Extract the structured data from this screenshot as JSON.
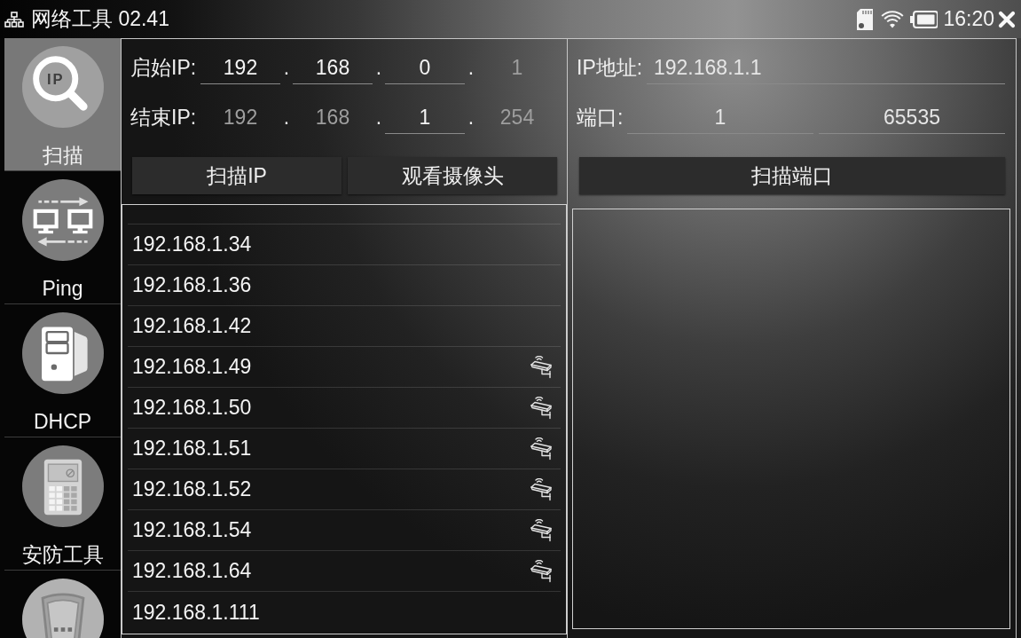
{
  "title_bar": {
    "title": "网络工具 02.41",
    "time": "16:20"
  },
  "sidebar": {
    "items": [
      {
        "kind": "ip-search",
        "icon_text": "IP",
        "label": "扫描",
        "selected": true
      },
      {
        "kind": "ping",
        "label": "Ping",
        "selected": false
      },
      {
        "kind": "dhcp",
        "label": "DHCP",
        "selected": false
      },
      {
        "kind": "security",
        "label": "安防工具",
        "selected": false
      },
      {
        "kind": "router",
        "selected": false
      }
    ]
  },
  "ip_scan": {
    "start": {
      "label": "启始IP:",
      "octets": [
        {
          "value": "192",
          "disabled": false
        },
        {
          "value": "168",
          "disabled": false
        },
        {
          "value": "0",
          "disabled": false
        },
        {
          "value": "1",
          "disabled": true
        }
      ],
      "separators": [
        ".",
        ".",
        "."
      ]
    },
    "end": {
      "label": "结束IP:",
      "octets": [
        {
          "value": "192",
          "disabled": true
        },
        {
          "value": "168",
          "disabled": true
        },
        {
          "value": "1",
          "disabled": false
        },
        {
          "value": "254",
          "disabled": true
        }
      ],
      "separators": [
        ".",
        ".",
        "."
      ]
    },
    "buttons": [
      "扫描IP",
      "观看摄像头"
    ],
    "results": [
      {
        "ip": "192.168.1.34",
        "camera": false
      },
      {
        "ip": "192.168.1.36",
        "camera": false
      },
      {
        "ip": "192.168.1.42",
        "camera": false
      },
      {
        "ip": "192.168.1.49",
        "camera": true
      },
      {
        "ip": "192.168.1.50",
        "camera": true
      },
      {
        "ip": "192.168.1.51",
        "camera": true
      },
      {
        "ip": "192.168.1.52",
        "camera": true
      },
      {
        "ip": "192.168.1.54",
        "camera": true
      },
      {
        "ip": "192.168.1.64",
        "camera": true
      },
      {
        "ip": "192.168.1.111",
        "camera": false
      }
    ]
  },
  "port_scan": {
    "ip_label": "IP地址:",
    "ip_value": "192.168.1.1",
    "port_label": "端口:",
    "ports": [
      "1",
      "65535"
    ],
    "button": "扫描端口"
  }
}
